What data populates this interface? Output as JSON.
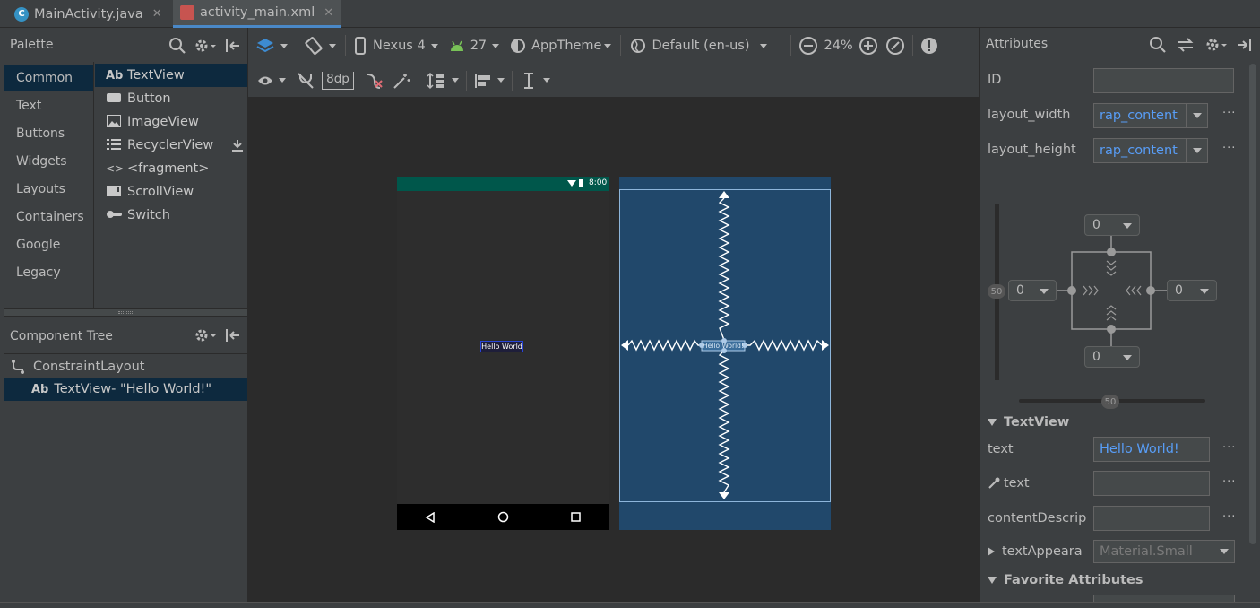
{
  "tabs": [
    {
      "label": "MainActivity.java",
      "icon": "java-class-icon",
      "active": false
    },
    {
      "label": "activity_main.xml",
      "icon": "layout-xml-icon",
      "active": true
    }
  ],
  "palette": {
    "title": "Palette",
    "categories": [
      "Common",
      "Text",
      "Buttons",
      "Widgets",
      "Layouts",
      "Containers",
      "Google",
      "Legacy"
    ],
    "selected_category": "Common",
    "components": [
      {
        "label": "TextView",
        "icon": "Ab"
      },
      {
        "label": "Button",
        "icon": "button-icon"
      },
      {
        "label": "ImageView",
        "icon": "image-icon"
      },
      {
        "label": "RecyclerView",
        "icon": "list-icon"
      },
      {
        "label": "<fragment>",
        "icon": "code-icon"
      },
      {
        "label": "ScrollView",
        "icon": "scroll-icon"
      },
      {
        "label": "Switch",
        "icon": "switch-icon"
      }
    ]
  },
  "component_tree": {
    "title": "Component Tree",
    "root": "ConstraintLayout",
    "child_icon": "Ab",
    "child": "TextView- \"Hello World!\""
  },
  "toolbar": {
    "device": "Nexus 4",
    "api": "27",
    "theme": "AppTheme",
    "locale": "Default (en-us)",
    "zoom": "24%",
    "margin": "8dp"
  },
  "phone": {
    "status_time": "8:00",
    "hello_text": "Hello World",
    "blueprint_text": "Hello World!"
  },
  "attributes": {
    "title": "Attributes",
    "id_label": "ID",
    "id_value": "",
    "layout_width_label": "layout_width",
    "layout_width_value": "rap_content",
    "layout_height_label": "layout_height",
    "layout_height_value": "rap_content",
    "constraint_top": "0",
    "constraint_left": "0",
    "constraint_right": "0",
    "constraint_bottom": "0",
    "bias_vertical": "50",
    "bias_horizontal": "50",
    "textview_section": "TextView",
    "text_label": "text",
    "text_value": "Hello World!",
    "tools_text_label": "text",
    "content_desc_label": "contentDescrip",
    "text_appearance_label": "textAppeara",
    "text_appearance_value": "Material.Small",
    "favorite_section": "Favorite Attributes"
  },
  "colors": {
    "accent": "#4a88c7",
    "link_text": "#589df6",
    "status_bar": "#00574b",
    "blueprint": "#21486b",
    "selection": "#0d293e"
  }
}
